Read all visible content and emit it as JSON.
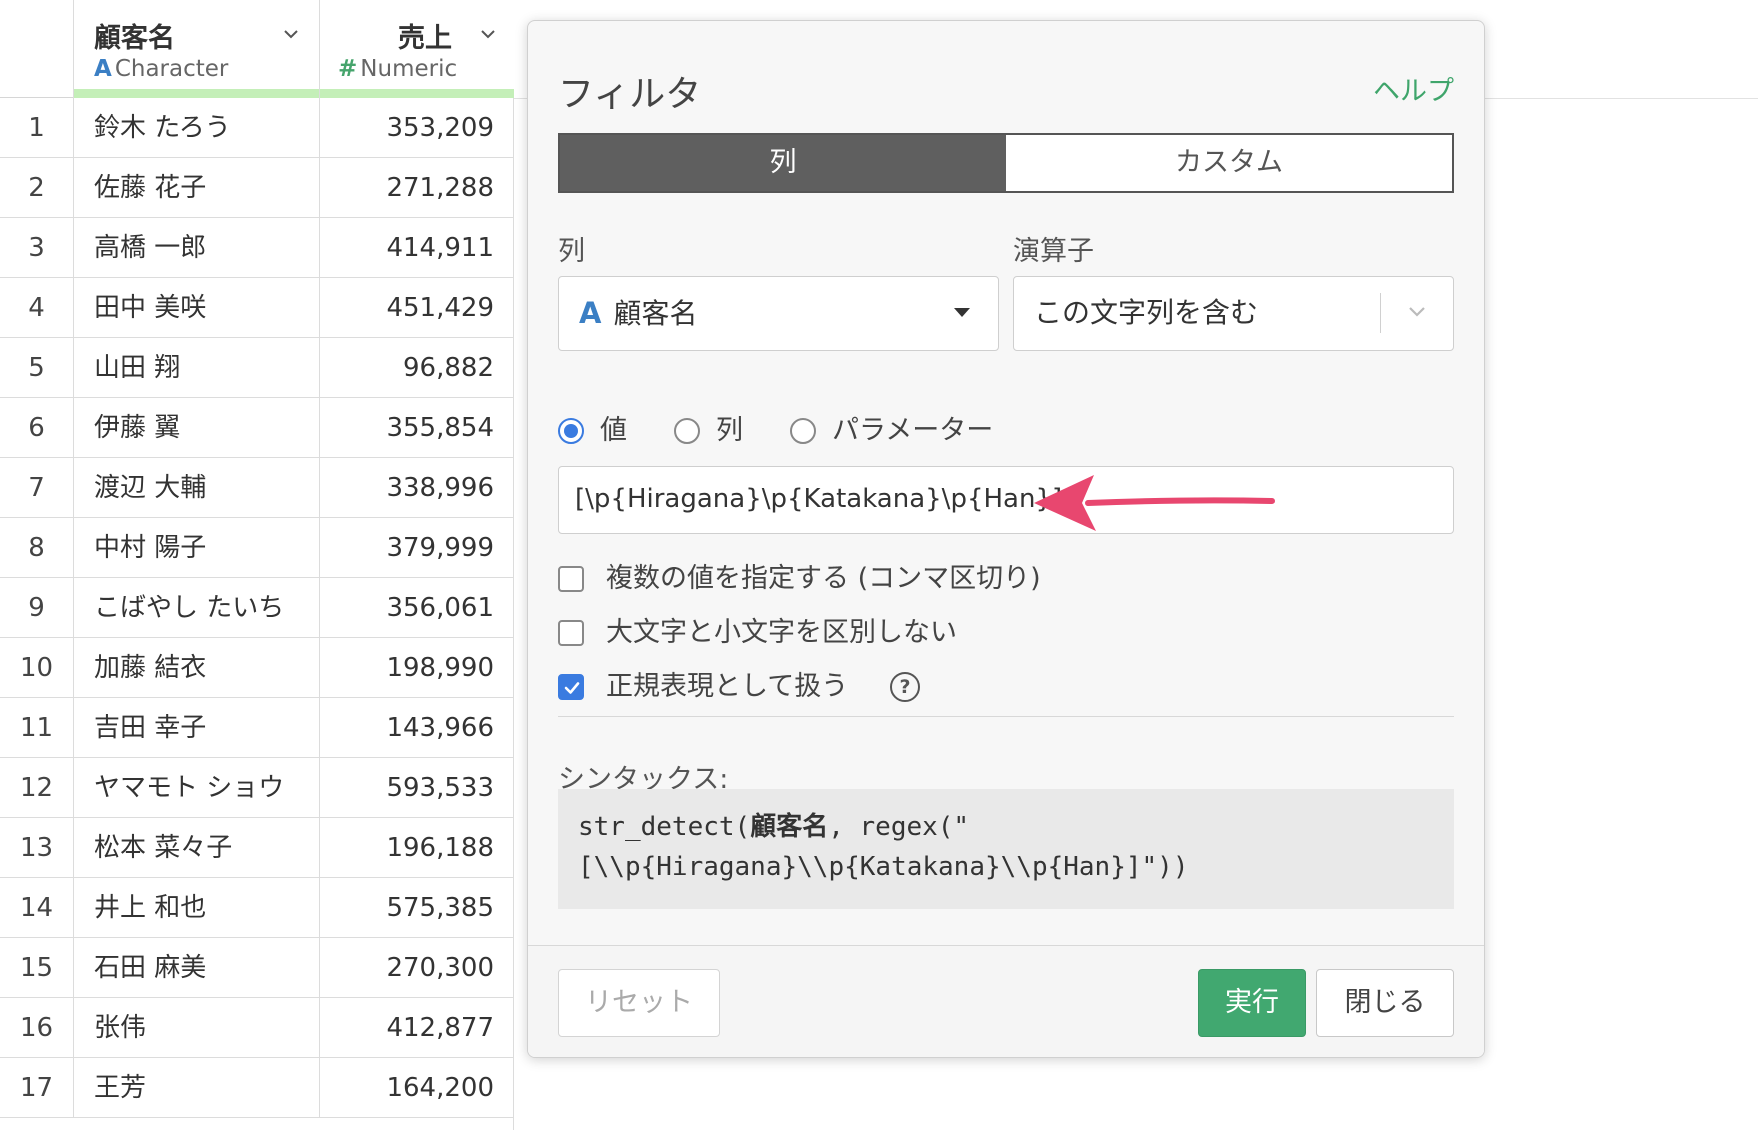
{
  "table": {
    "columns": [
      {
        "name": "顧客名",
        "type_icon": "A",
        "type": "Character"
      },
      {
        "name": "売上",
        "type_icon": "#",
        "type": "Numeric"
      }
    ],
    "rows": [
      {
        "idx": "1",
        "name": "鈴木 たろう",
        "sales": "353,209"
      },
      {
        "idx": "2",
        "name": "佐藤 花子",
        "sales": "271,288"
      },
      {
        "idx": "3",
        "name": "高橋 一郎",
        "sales": "414,911"
      },
      {
        "idx": "4",
        "name": "田中 美咲",
        "sales": "451,429"
      },
      {
        "idx": "5",
        "name": "山田 翔",
        "sales": "96,882"
      },
      {
        "idx": "6",
        "name": "伊藤 翼",
        "sales": "355,854"
      },
      {
        "idx": "7",
        "name": "渡辺 大輔",
        "sales": "338,996"
      },
      {
        "idx": "8",
        "name": "中村 陽子",
        "sales": "379,999"
      },
      {
        "idx": "9",
        "name": "こばやし たいち",
        "sales": "356,061"
      },
      {
        "idx": "10",
        "name": "加藤 結衣",
        "sales": "198,990"
      },
      {
        "idx": "11",
        "name": "吉田 幸子",
        "sales": "143,966"
      },
      {
        "idx": "12",
        "name": "ヤマモト ショウ",
        "sales": "593,533"
      },
      {
        "idx": "13",
        "name": "松本 菜々子",
        "sales": "196,188"
      },
      {
        "idx": "14",
        "name": "井上 和也",
        "sales": "575,385"
      },
      {
        "idx": "15",
        "name": "石田 麻美",
        "sales": "270,300"
      },
      {
        "idx": "16",
        "name": "张伟",
        "sales": "412,877"
      },
      {
        "idx": "17",
        "name": "王芳",
        "sales": "164,200"
      }
    ]
  },
  "dialog": {
    "title": "フィルタ",
    "help": "ヘルプ",
    "tabs": [
      "列",
      "カスタム"
    ],
    "column_label": "列",
    "operator_label": "演算子",
    "column_value_icon": "A",
    "column_value": "顧客名",
    "operator_value": "この文字列を含む",
    "radios": [
      "値",
      "列",
      "パラメーター"
    ],
    "value_input": "[\\p{Hiragana}\\p{Katakana}\\p{Han}]",
    "checkboxes": [
      {
        "label": "複数の値を指定する (コンマ区切り)",
        "checked": false
      },
      {
        "label": "大文字と小文字を区別しない",
        "checked": false
      },
      {
        "label": "正規表現として扱う",
        "checked": true
      }
    ],
    "help_icon_glyph": "?",
    "syntax_label": "シンタックス:",
    "syntax_line1_pre": "str_detect(",
    "syntax_line1_bold": "顧客名",
    "syntax_line1_post": ", regex(\"",
    "syntax_line2": "[\\\\p{Hiragana}\\\\p{Katakana}\\\\p{Han}]\"))",
    "reset": "リセット",
    "run": "実行",
    "close": "閉じる"
  },
  "colors": {
    "accent": "#3a7be0",
    "run": "#41a870",
    "help": "#3fa56b",
    "arrow": "#e8476f"
  }
}
